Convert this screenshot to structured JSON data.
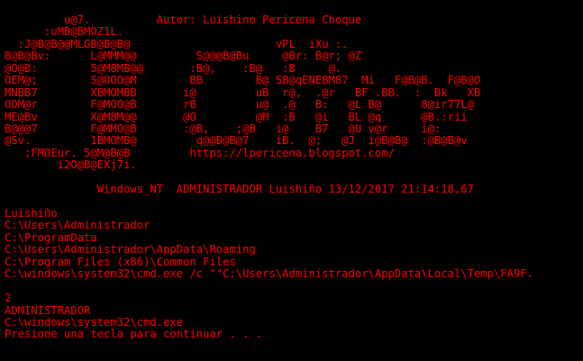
{
  "console": {
    "text_color": "#FF0000",
    "background": "#000000",
    "ascii_art": [
      "         u@7.          Autor: Luishino Pericena Choque",
      "      :uMB@BMOZ1L.",
      "  :J@B@B@@MLGB@B@B@                      vPL  iXu :.",
      "B@B@Bv:      L@MMM@@         S@@@B@Bu     @Br: B@r; @Z",
      "@O@B:        5@M8MB@@       :B@,    :B@   :B     @.",
      "OEM@;        S@OOO@M        BB        B@ SB@qENEBM87  Mi   F@B@B.  F@B@O",
      "MNBB7        XBMOMBB       i@         uB  r@,  .@r   BF .BB.  :  Bk   XB",
      "OOM@r        F@MOO@B       rB         u@  .@   B:   @L B@      8@ir77L@",
      "ME@Bv        X@M8M@@       @O         @M  :B   @i   BL @q      @B.:rii",
      "B@@@7        F@MMO@B       :@B,    ;@B   i@    B7   @U v@r     i@:",
      "@Sv.         1BMOMB@         q@@B@B@7    iB.  @;   @J  i@B@B@  :@B@B@v",
      "   ;FMOEur. 5@M@B@B         https://lpericena.blogspot.com/",
      "        i2O@B@EXj7i."
    ],
    "header_line": "              Windows_NT  ADMINISTRADOR Luishiño 13/12/2017 21:14:18,67",
    "output_block_1": [
      "Luishiño",
      "C:\\Users\\Administrador",
      "C:\\ProgramData",
      "C:\\Users\\Administrador\\AppData\\Roaming",
      "C:\\Program Files (x86)\\Common Files",
      "C:\\windows\\system32\\cmd.exe /c \"\"C:\\Users\\Administrador\\AppData\\Local\\Temp\\FA9F."
    ],
    "output_block_2": [
      "2",
      "ADMINISTRADOR",
      "C:\\windows\\system32\\cmd.exe",
      "Presione una tecla para continuar . . ."
    ]
  }
}
